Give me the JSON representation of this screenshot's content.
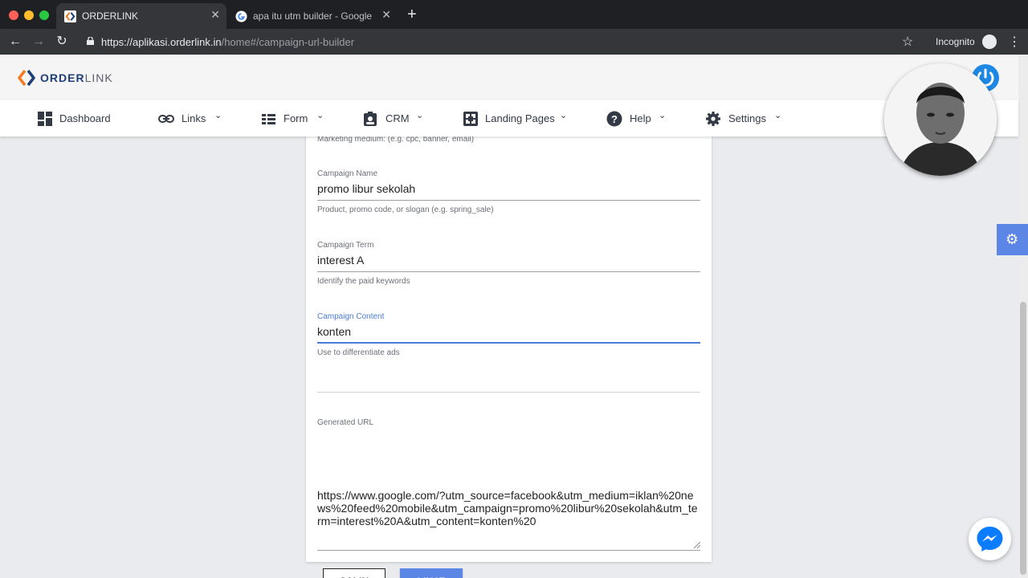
{
  "browser": {
    "tabs": [
      {
        "title": "ORDERLINK",
        "active": true
      },
      {
        "title": "apa itu utm builder - Google Se",
        "active": false
      }
    ],
    "url_host": "https://aplikasi.orderlink.in",
    "url_path": "/home#/campaign-url-builder",
    "mode_label": "Incognito"
  },
  "header": {
    "logo_order": "ORDER",
    "logo_link": "LINK"
  },
  "nav": {
    "items": [
      {
        "label": "Dashboard",
        "icon": "dashboard-icon"
      },
      {
        "label": "Links",
        "icon": "link-icon"
      },
      {
        "label": "Form",
        "icon": "form-icon"
      },
      {
        "label": "CRM",
        "icon": "crm-icon"
      },
      {
        "label": "Landing Pages",
        "icon": "landing-pages-icon"
      },
      {
        "label": "Help",
        "icon": "help-icon"
      },
      {
        "label": "Settings",
        "icon": "settings-icon"
      }
    ]
  },
  "form": {
    "medium_hint": "Marketing medium: (e.g. cpc, banner, email)",
    "campaign_name": {
      "label": "Campaign Name",
      "value": "promo libur sekolah",
      "hint": "Product, promo code, or slogan (e.g. spring_sale)"
    },
    "campaign_term": {
      "label": "Campaign Term",
      "value": "interest A",
      "hint": "Identify the paid keywords"
    },
    "campaign_content": {
      "label": "Campaign Content",
      "value": "konten",
      "hint": "Use to differentiate ads"
    },
    "generated_url": {
      "label": "Generated URL",
      "value": "https://www.google.com/?utm_source=facebook&utm_medium=iklan%20news%20feed%20mobile&utm_campaign=promo%20libur%20sekolah&utm_term=interest%20A&utm_content=konten%20"
    },
    "copy_button": "SALIN",
    "view_button": "LIHAT"
  },
  "colors": {
    "accent": "#5b86e5",
    "focus": "#4a7bd8",
    "brand_dark": "#1d3f77"
  }
}
